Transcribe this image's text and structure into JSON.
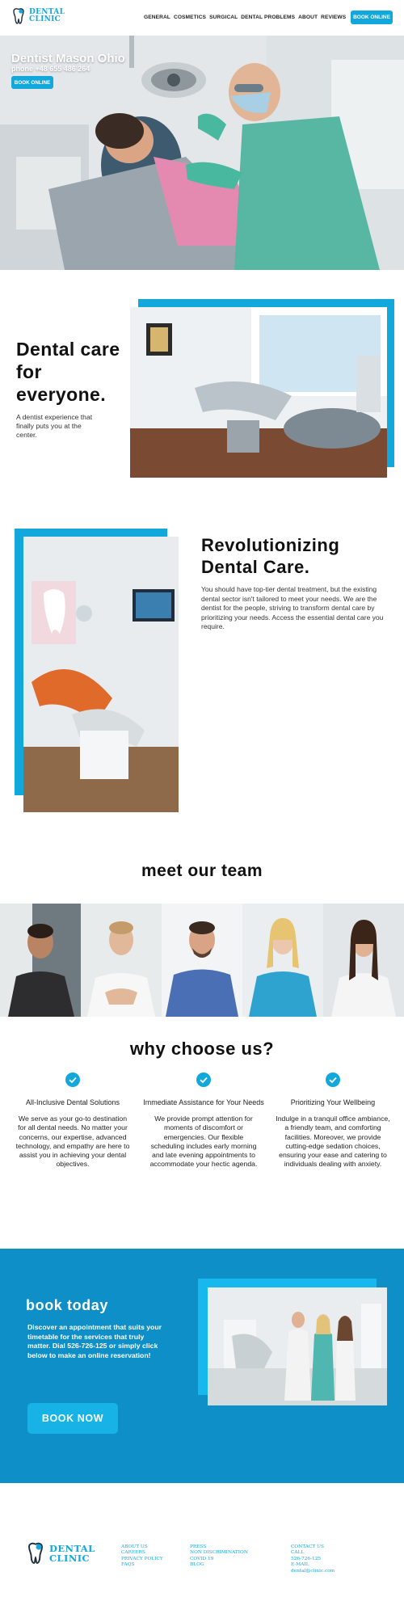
{
  "header": {
    "logo": {
      "line1": "DENTAL",
      "line2": "CLINIC"
    },
    "nav": [
      "GENERAL",
      "COSMETICS",
      "SURGICAL",
      "DENTAL PROBLEMS",
      "ABOUT",
      "REVIEWS"
    ],
    "book_button": "BOOK ONLINE"
  },
  "hero": {
    "title": "Dentist Mason Ohio",
    "phone": "phone +48 655 486 264",
    "book_button": "BOOK ONLINE"
  },
  "intro": {
    "title": "Dental care for everyone.",
    "text": "A dentist experience that finally puts you at the center."
  },
  "revolution": {
    "title": "Revolutionizing Dental Care.",
    "text": "You should have top-tier dental treatment, but the existing dental sector isn't tailored to meet your needs. We are the dentist for the people, striving to transform dental care by prioritizing your needs. Access the essential dental care you require."
  },
  "team": {
    "title": "meet our team"
  },
  "why": {
    "title": "why choose us?",
    "items": [
      {
        "heading": "All-Inclusive Dental Solutions",
        "text": "We serve as your go-to destination for all dental needs. No matter your concerns, our expertise, advanced technology, and empathy are here to assist you in achieving your dental objectives."
      },
      {
        "heading": "Immediate Assistance for Your Needs",
        "text": "We provide prompt attention for moments of discomfort or emergencies. Our flexible scheduling includes early morning and late evening appointments to accommodate your hectic agenda."
      },
      {
        "heading": "Prioritizing Your Wellbeing",
        "text": "Indulge in a tranquil office ambiance, a friendly team, and comforting facilities. Moreover, we provide cutting-edge sedation choices, ensuring your ease and catering to individuals dealing with anxiety."
      }
    ]
  },
  "book": {
    "title": "book today",
    "text": "Discover an appointment that suits your timetable for the services that truly matter. Dial 526-726-125 or simply click below to make an online reservation!",
    "button": "BOOK NOW"
  },
  "footer": {
    "logo": {
      "line1": "DENTAL",
      "line2": "CLINIC"
    },
    "col1": [
      "ABOUT US",
      "CAREERS",
      "PRIVACY POLICY",
      "FAQS"
    ],
    "col2": [
      "PRESS",
      "NON DISCRIMINATION",
      "COVID 19",
      "BLOG"
    ],
    "col3": [
      "CONTACT US",
      "CALL",
      "526-726-125",
      "E-MAIL",
      "dental@clinic.com"
    ]
  },
  "colors": {
    "accent": "#12a8dc",
    "book_bg": "#0e8fc7",
    "text": "#1a1a1a"
  }
}
